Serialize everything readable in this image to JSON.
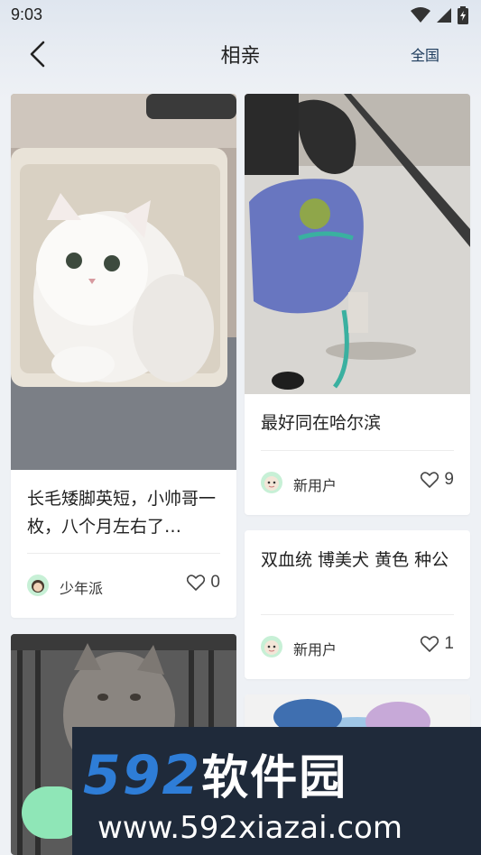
{
  "status_bar": {
    "time": "9:03"
  },
  "header": {
    "title": "相亲",
    "region": "全国"
  },
  "cards": [
    {
      "title": "长毛矮脚英短，小帅哥一枚，八个月左右了…",
      "author": "少年派",
      "likes": "0"
    },
    {
      "title": "最好同在哈尔滨",
      "author": "新用户",
      "likes": "9"
    },
    {
      "title": "双血统 博美犬 黄色 种公",
      "author": "新用户",
      "likes": "1"
    }
  ],
  "watermark": {
    "brand_num": "592",
    "brand_cn": "软件园",
    "url": "www.592xiazai.com"
  },
  "colors": {
    "accent_green": "#8fe6b7",
    "avatar_bg": "#c7f0d6",
    "region_text": "#1d3b5c"
  }
}
